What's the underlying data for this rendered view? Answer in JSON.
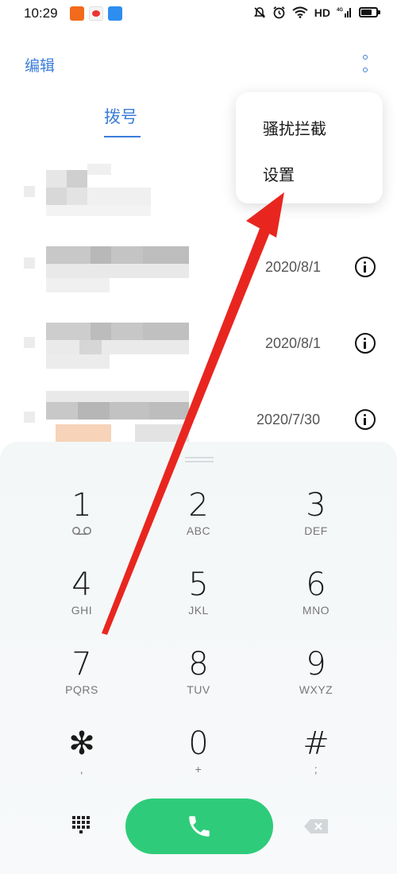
{
  "status_bar": {
    "time": "10:29",
    "network": "HD",
    "signal_tag": "4G",
    "icons": [
      "news-app-icon",
      "weibo-icon",
      "message-app-icon",
      "mute-icon",
      "alarm-icon",
      "wifi-icon",
      "signal-icon",
      "battery-icon"
    ]
  },
  "header": {
    "edit_label": "编辑",
    "more_icon": "more-vertical-icon"
  },
  "tabs": [
    {
      "label": "拨号",
      "active": true
    }
  ],
  "call_log": [
    {
      "name": "",
      "date": ""
    },
    {
      "name": "",
      "date": "2020/8/1"
    },
    {
      "name": "",
      "date": "2020/8/1"
    },
    {
      "name": "",
      "date": "2020/7/30"
    }
  ],
  "popup_menu": {
    "items": [
      "骚扰拦截",
      "设置"
    ]
  },
  "dialpad": {
    "keys": [
      {
        "digit": "1",
        "letters": ""
      },
      {
        "digit": "2",
        "letters": "ABC"
      },
      {
        "digit": "3",
        "letters": "DEF"
      },
      {
        "digit": "4",
        "letters": "GHI"
      },
      {
        "digit": "5",
        "letters": "JKL"
      },
      {
        "digit": "6",
        "letters": "MNO"
      },
      {
        "digit": "7",
        "letters": "PQRS"
      },
      {
        "digit": "8",
        "letters": "TUV"
      },
      {
        "digit": "9",
        "letters": "WXYZ"
      },
      {
        "digit": "✻",
        "letters": ","
      },
      {
        "digit": "0",
        "letters": "+"
      },
      {
        "digit": "#",
        "letters": ";"
      }
    ]
  },
  "colors": {
    "accent": "#3b7dd8",
    "call_green": "#2ecc7a",
    "annotation_arrow": "#e8261f"
  }
}
